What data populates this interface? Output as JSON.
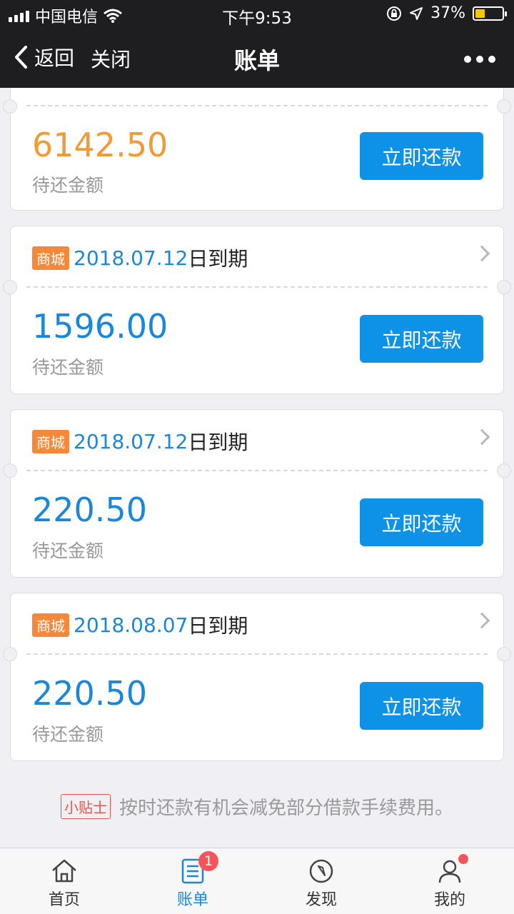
{
  "status_bar": {
    "carrier": "中国电信",
    "time": "下午9:53",
    "battery_percent": "37%",
    "battery_level": 0.37
  },
  "nav": {
    "back_label": "返回",
    "close_label": "关闭",
    "title": "账单"
  },
  "bills": [
    {
      "amount": "6142.50",
      "amount_label": "待还金额",
      "pay_label": "立即还款"
    },
    {
      "tag": "商城",
      "due_date": "2018.07.12",
      "due_suffix": "日到期",
      "amount": "1596.00",
      "amount_label": "待还金额",
      "pay_label": "立即还款"
    },
    {
      "tag": "商城",
      "due_date": "2018.07.12",
      "due_suffix": "日到期",
      "amount": "220.50",
      "amount_label": "待还金额",
      "pay_label": "立即还款"
    },
    {
      "tag": "商城",
      "due_date": "2018.08.07",
      "due_suffix": "日到期",
      "amount": "220.50",
      "amount_label": "待还金额",
      "pay_label": "立即还款"
    }
  ],
  "tip": {
    "badge": "小贴士",
    "text": "按时还款有机会减免部分借款手续费用。"
  },
  "tabs": [
    {
      "label": "首页",
      "icon": "home-icon"
    },
    {
      "label": "账单",
      "icon": "bill-icon",
      "badge": "1"
    },
    {
      "label": "发现",
      "icon": "compass-icon"
    },
    {
      "label": "我的",
      "icon": "user-icon"
    }
  ],
  "colors": {
    "accent": "#1a87d8",
    "button": "#0d92e7",
    "highlight_amount": "#f39a33",
    "tag": "#f6883a",
    "badge": "#f5555a"
  }
}
